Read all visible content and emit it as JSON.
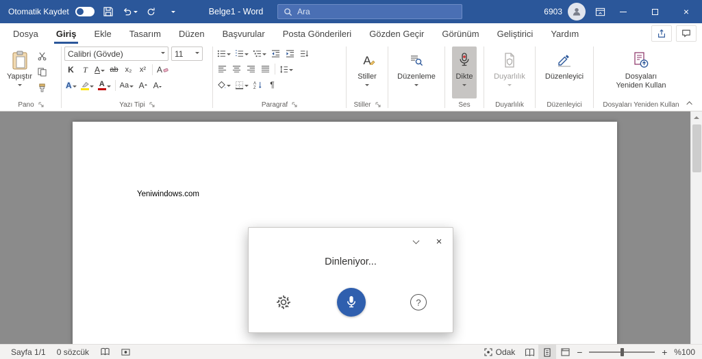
{
  "titlebar": {
    "autosave": "Otomatik Kaydet",
    "title": "Belge1 - Word",
    "search": "Ara",
    "user": "6903"
  },
  "tabs": [
    "Dosya",
    "Giriş",
    "Ekle",
    "Tasarım",
    "Düzen",
    "Başvurular",
    "Posta Gönderileri",
    "Gözden Geçir",
    "Görünüm",
    "Geliştirici",
    "Yardım"
  ],
  "ribbon": {
    "paste": "Yapıştır",
    "font_name": "Calibri (Gövde)",
    "font_size": "11",
    "bold": "K",
    "italic": "T",
    "underline": "A",
    "strike": "ab",
    "subscript": "x₂",
    "superscript": "x²",
    "clear_format": "A",
    "effects": "A",
    "font_color": "A",
    "change_case": "Aa",
    "grow": "A",
    "shrink": "A",
    "pilcrow": "¶",
    "styles_button": "Stiller",
    "editing_button": "Düzenleme",
    "dictate_button": "Dikte",
    "sensitivity_button": "Duyarlılık",
    "editor_button": "Düzenleyici",
    "reuse_line1": "Dosyaları",
    "reuse_line2": "Yeniden Kullan",
    "groups": {
      "clipboard": "Pano",
      "font": "Yazı Tipi",
      "paragraph": "Paragraf",
      "styles": "Stiller",
      "voice": "Ses",
      "sensitivity": "Duyarlılık",
      "editor": "Düzenleyici",
      "reuse": "Dosyaları Yeniden Kullan"
    }
  },
  "document": {
    "text": "Yeniwindows.com"
  },
  "dictation": {
    "status": "Dinleniyor..."
  },
  "statusbar": {
    "page": "Sayfa 1/1",
    "words": "0 sözcük",
    "focus": "Odak",
    "zoom": "%100"
  },
  "colors": {
    "titlebar": "#2b579a",
    "accent": "#2b579a",
    "mic_button": "#2f5fae",
    "record_red": "#d13438",
    "highlight_yellow": "#ffe400",
    "font_color_red": "#c00000"
  }
}
